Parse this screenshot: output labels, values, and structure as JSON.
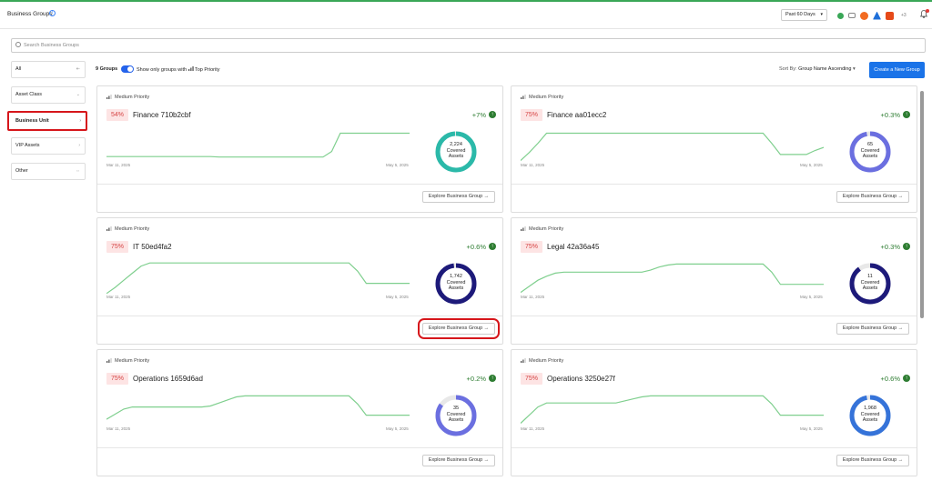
{
  "header": {
    "title": "Business Groups",
    "period": "Past 60 Days",
    "extra_count": "+3"
  },
  "search": {
    "placeholder": "Search Business Groups"
  },
  "sidebar": {
    "items": [
      {
        "label": "All",
        "active": false
      },
      {
        "label": "Asset Class",
        "active": false
      },
      {
        "label": "Business Unit",
        "active": true
      },
      {
        "label": "VIP Assets",
        "active": false
      },
      {
        "label": "Other",
        "active": false
      }
    ]
  },
  "toolbar": {
    "count": "9 Groups",
    "toggle_label": "Show only groups with",
    "toggle_suffix": "Top Priority",
    "sort_label": "Sort By:",
    "sort_value": "Group Name Ascending",
    "create_label": "Create a New Group"
  },
  "cards": [
    {
      "priority": "Medium Priority",
      "percent": "54%",
      "name": "Finance 710b2cbf",
      "delta": "+7%",
      "covered": "2,224",
      "covered_label": "Covered Assets",
      "date_start": "Mar 11, 2025",
      "date_end": "May 5, 2025",
      "explore": "Explore Business Group",
      "donut_color": "#2bb9a9",
      "fill": 0.99,
      "spark": [
        7,
        7,
        7,
        7,
        7,
        7,
        7,
        7,
        7,
        7,
        7,
        7,
        7,
        6.5,
        6.5,
        6.5,
        6.5,
        6.5,
        6.5,
        6.5,
        6.5,
        6.5,
        6.5,
        6.5,
        6.5,
        6.5,
        12,
        30,
        30,
        30,
        30,
        30,
        30,
        30,
        30,
        30
      ]
    },
    {
      "priority": "Medium Priority",
      "percent": "75%",
      "name": "Finance aa01ecc2",
      "delta": "+0.3%",
      "covered": "65",
      "covered_label": "Covered Assets",
      "date_start": "Mar 11, 2025",
      "date_end": "May 5, 2025",
      "explore": "Explore Business Group",
      "donut_color": "#6b6fe0",
      "fill": 0.97,
      "spark": [
        3,
        11,
        20,
        30,
        30,
        30,
        30,
        30,
        30,
        30,
        30,
        30,
        30,
        30,
        30,
        30,
        30,
        30,
        30,
        30,
        30,
        30,
        30,
        30,
        30,
        30,
        30,
        30,
        30,
        20,
        9,
        9,
        9,
        9,
        13,
        16
      ]
    },
    {
      "priority": "Medium Priority",
      "percent": "75%",
      "name": "IT 50ed4fa2",
      "delta": "+0.6%",
      "covered": "1,742",
      "covered_label": "Covered Assets",
      "date_start": "Mar 11, 2025",
      "date_end": "May 5, 2025",
      "explore": "Explore Business Group",
      "donut_color": "#1d1a7a",
      "fill": 0.98,
      "spark": [
        2,
        8,
        15,
        22,
        29,
        32,
        32,
        32,
        32,
        32,
        32,
        32,
        32,
        32,
        32,
        32,
        32,
        32,
        32,
        32,
        32,
        32,
        32,
        32,
        32,
        32,
        32,
        32,
        32,
        24,
        12,
        12,
        12,
        12,
        12,
        12
      ]
    },
    {
      "priority": "Medium Priority",
      "percent": "75%",
      "name": "Legal 42a36a45",
      "delta": "+0.3%",
      "covered": "11",
      "covered_label": "Covered Assets",
      "date_start": "Mar 11, 2025",
      "date_end": "May 5, 2025",
      "explore": "Explore Business Group",
      "donut_color": "#1d1a7a",
      "fill": 0.9,
      "spark": [
        3,
        9,
        15,
        19,
        22,
        23,
        23,
        23,
        23,
        23,
        23,
        23,
        23,
        23,
        23,
        25,
        28,
        30,
        31,
        31,
        31,
        31,
        31,
        31,
        31,
        31,
        31,
        31,
        31,
        23,
        11,
        11,
        11,
        11,
        11,
        11
      ]
    },
    {
      "priority": "Medium Priority",
      "percent": "75%",
      "name": "Operations 1659d6ad",
      "delta": "+0.2%",
      "covered": "35",
      "covered_label": "Covered Assets",
      "date_start": "Mar 11, 2025",
      "date_end": "May 5, 2025",
      "explore": "Explore Business Group",
      "donut_color": "#6b6fe0",
      "fill": 0.85,
      "spark": [
        8,
        13,
        18,
        20,
        20,
        20,
        20,
        20,
        20,
        20,
        20,
        20,
        21,
        24,
        27,
        30,
        31,
        31,
        31,
        31,
        31,
        31,
        31,
        31,
        31,
        31,
        31,
        31,
        31,
        23,
        12,
        12,
        12,
        12,
        12,
        12
      ]
    },
    {
      "priority": "Medium Priority",
      "percent": "75%",
      "name": "Operations 3250e27f",
      "delta": "+0.6%",
      "covered": "1,968",
      "covered_label": "Covered Assets",
      "date_start": "Mar 11, 2025",
      "date_end": "May 5, 2025",
      "explore": "Explore Business Group",
      "donut_color": "#3573d9",
      "fill": 0.97,
      "spark": [
        4,
        12,
        20,
        24,
        24,
        24,
        24,
        24,
        24,
        24,
        24,
        24,
        26,
        28,
        30,
        31,
        31,
        31,
        31,
        31,
        31,
        31,
        31,
        31,
        31,
        31,
        31,
        31,
        31,
        23,
        12,
        12,
        12,
        12,
        12,
        12
      ]
    }
  ]
}
